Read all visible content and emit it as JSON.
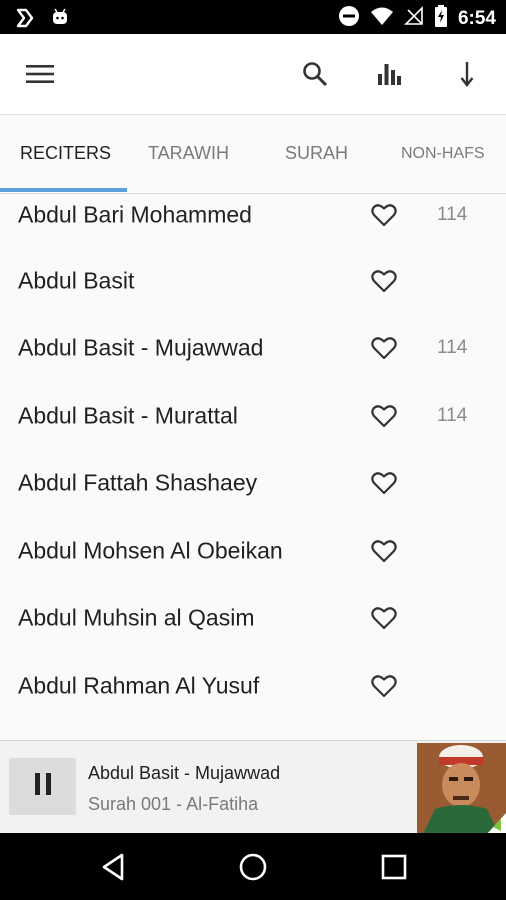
{
  "status_bar": {
    "time": "6:54",
    "left_icons": [
      "plex-icon",
      "android-debug-icon"
    ],
    "right_icons": [
      "do-not-disturb-icon",
      "wifi-icon",
      "no-signal-icon",
      "battery-charging-icon"
    ]
  },
  "app_bar": {
    "icons": [
      "menu-icon",
      "search-icon",
      "equalizer-icon",
      "download-icon"
    ]
  },
  "tabs": [
    {
      "label": "RECITERS",
      "active": true
    },
    {
      "label": "TARAWIH",
      "active": false
    },
    {
      "label": "SURAH",
      "active": false
    },
    {
      "label": "NON-HAFS",
      "active": false
    }
  ],
  "reciters": [
    {
      "name": "Abdul Bari Mohammed",
      "count": "114"
    },
    {
      "name": "Abdul Basit",
      "count": ""
    },
    {
      "name": "Abdul Basit - Mujawwad",
      "count": "114"
    },
    {
      "name": "Abdul Basit - Murattal",
      "count": "114"
    },
    {
      "name": "Abdul Fattah Shashaey",
      "count": ""
    },
    {
      "name": "Abdul Mohsen Al Obeikan",
      "count": ""
    },
    {
      "name": "Abdul Muhsin al Qasim",
      "count": ""
    },
    {
      "name": "Abdul Rahman Al Yusuf",
      "count": ""
    }
  ],
  "player": {
    "title": "Abdul Basit - Mujawwad",
    "subtitle": "Surah 001 - Al-Fatiha",
    "state_icon": "pause-icon"
  },
  "nav_bar": {
    "icons": [
      "back-icon",
      "home-icon",
      "recents-icon"
    ]
  },
  "colors": {
    "tab_indicator": "#5aa0dc",
    "status_bar": "#000000",
    "background": "#fafafa"
  }
}
